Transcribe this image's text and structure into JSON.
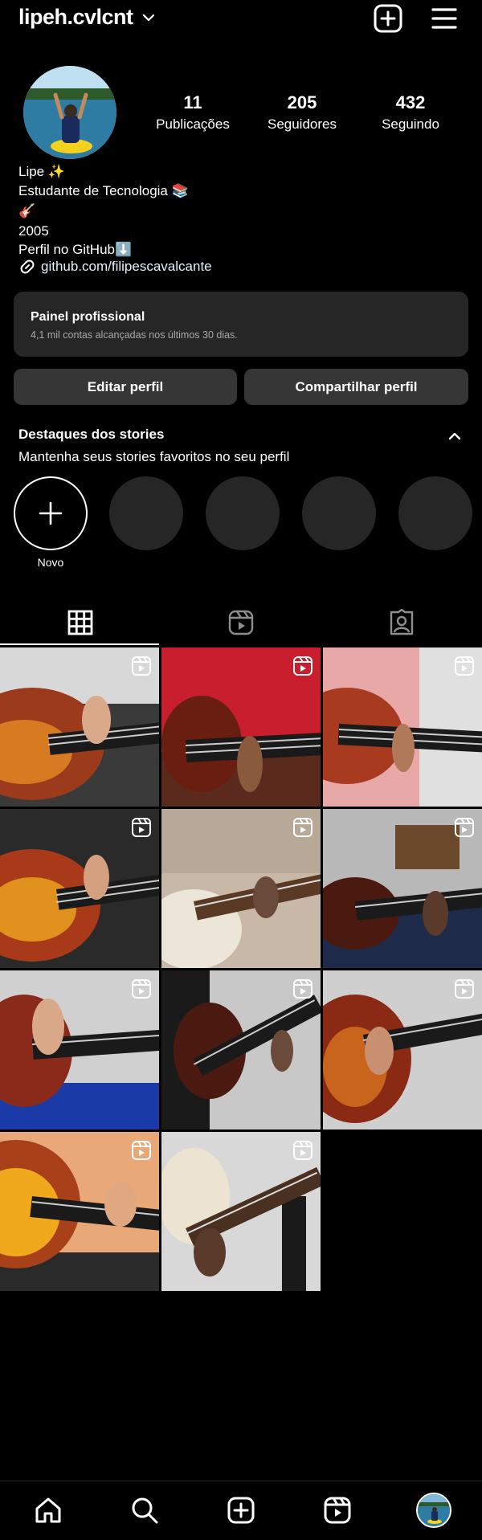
{
  "header": {
    "username": "lipeh.cvlcnt",
    "icons": [
      "chevron-down-icon",
      "new-post-icon",
      "menu-icon"
    ]
  },
  "profile": {
    "stats": [
      {
        "value": "11",
        "label": "Publicações"
      },
      {
        "value": "205",
        "label": "Seguidores"
      },
      {
        "value": "432",
        "label": "Seguindo"
      }
    ],
    "bio_lines": [
      "Lipe ✨",
      "Estudante de Tecnologia 📚",
      "🎸",
      "2005",
      "Perfil no GitHub⬇️"
    ],
    "link": "github.com/filipescavalcante"
  },
  "dashboard": {
    "title": "Painel profissional",
    "subtitle": "4,1 mil contas alcançadas nos últimos 30 dias."
  },
  "buttons": {
    "edit": "Editar perfil",
    "share": "Compartilhar perfil"
  },
  "highlights": {
    "title": "Destaques dos stories",
    "subtitle": "Mantenha seus stories favoritos no seu perfil",
    "new_label": "Novo"
  },
  "tabs": [
    "grid-icon",
    "reels-icon",
    "tagged-icon"
  ],
  "grid": {
    "post_count": 11,
    "badge_icon": "reel-icon"
  },
  "bottom_nav": [
    "home-icon",
    "search-icon",
    "create-icon",
    "reels-icon",
    "profile-avatar"
  ],
  "colors": {
    "background": "#000000",
    "card": "#262626",
    "button": "#363636",
    "link": "#e0f1ff",
    "muted": "#a8a8a8"
  }
}
